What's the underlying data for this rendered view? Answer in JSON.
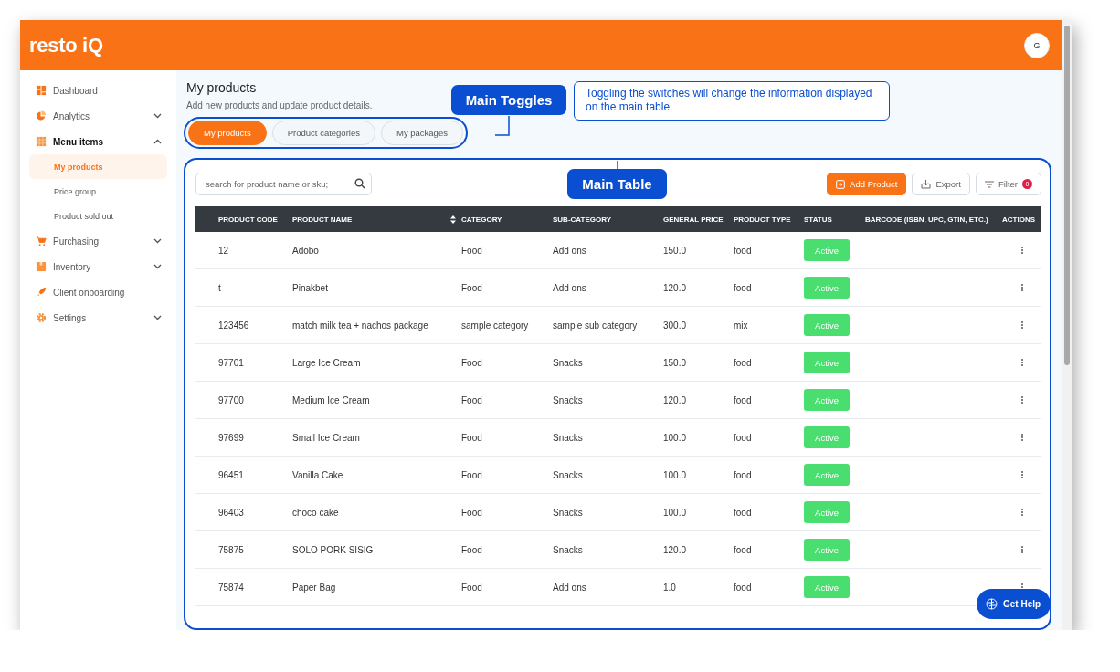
{
  "header": {
    "logo": "resto iQ",
    "avatar": "G"
  },
  "sidebar": {
    "items": [
      {
        "label": "Dashboard",
        "kind": "link",
        "selected": false
      },
      {
        "label": "Analytics",
        "kind": "group",
        "expanded": false,
        "selected": false
      },
      {
        "label": "Menu items",
        "kind": "group",
        "expanded": true,
        "selected": true,
        "children": [
          {
            "label": "My products",
            "selected": true
          },
          {
            "label": "Price group",
            "selected": false
          },
          {
            "label": "Product sold out",
            "selected": false
          }
        ]
      },
      {
        "label": "Purchasing",
        "kind": "group",
        "expanded": false,
        "selected": false
      },
      {
        "label": "Inventory",
        "kind": "group",
        "expanded": false,
        "selected": false
      },
      {
        "label": "Client onboarding",
        "kind": "link",
        "selected": false
      },
      {
        "label": "Settings",
        "kind": "group",
        "expanded": false,
        "selected": false
      }
    ]
  },
  "page": {
    "title": "My products",
    "subtitle": "Add new products and update product details.",
    "tabs": [
      {
        "label": "My products",
        "selected": true
      },
      {
        "label": "Product categories",
        "selected": false
      },
      {
        "label": "My packages",
        "selected": false
      }
    ],
    "search": {
      "placeholder": "search for product name or sku;"
    },
    "buttons": {
      "add": "Add Product",
      "export": "Export",
      "filter": "Filter",
      "filter_count": "0"
    },
    "table": {
      "columns": [
        {
          "label": "PRODUCT CODE",
          "sortable": false
        },
        {
          "label": "PRODUCT NAME",
          "sortable": true
        },
        {
          "label": "CATEGORY",
          "sortable": false
        },
        {
          "label": "SUB-CATEGORY",
          "sortable": false
        },
        {
          "label": "GENERAL PRICE",
          "sortable": false
        },
        {
          "label": "PRODUCT TYPE",
          "sortable": false
        },
        {
          "label": "STATUS",
          "sortable": false
        },
        {
          "label": "BARCODE (ISBN, UPC, GTIN, ETC.)",
          "sortable": false
        },
        {
          "label": "ACTIONS",
          "sortable": false
        }
      ],
      "rows": [
        {
          "code": "12",
          "name": "Adobo",
          "category": "Food",
          "sub_category": "Add ons",
          "price": "150.0",
          "type": "food",
          "status": "Active"
        },
        {
          "code": "t",
          "name": "Pinakbet",
          "category": "Food",
          "sub_category": "Add ons",
          "price": "120.0",
          "type": "food",
          "status": "Active"
        },
        {
          "code": "123456",
          "name": "match milk tea + nachos package",
          "category": "sample category",
          "sub_category": "sample sub category",
          "price": "300.0",
          "type": "mix",
          "status": "Active"
        },
        {
          "code": "97701",
          "name": "Large Ice Cream",
          "category": "Food",
          "sub_category": "Snacks",
          "price": "150.0",
          "type": "food",
          "status": "Active"
        },
        {
          "code": "97700",
          "name": "Medium Ice Cream",
          "category": "Food",
          "sub_category": "Snacks",
          "price": "120.0",
          "type": "food",
          "status": "Active"
        },
        {
          "code": "97699",
          "name": "Small Ice Cream",
          "category": "Food",
          "sub_category": "Snacks",
          "price": "100.0",
          "type": "food",
          "status": "Active"
        },
        {
          "code": "96451",
          "name": "Vanilla Cake",
          "category": "Food",
          "sub_category": "Snacks",
          "price": "100.0",
          "type": "food",
          "status": "Active"
        },
        {
          "code": "96403",
          "name": "choco cake",
          "category": "Food",
          "sub_category": "Snacks",
          "price": "100.0",
          "type": "food",
          "status": "Active"
        },
        {
          "code": "75875",
          "name": "SOLO PORK SISIG",
          "category": "Food",
          "sub_category": "Snacks",
          "price": "120.0",
          "type": "food",
          "status": "Active"
        },
        {
          "code": "75874",
          "name": "Paper Bag",
          "category": "Food",
          "sub_category": "Add ons",
          "price": "1.0",
          "type": "food",
          "status": "Active"
        }
      ]
    }
  },
  "annotations": {
    "toggles_tag": "Main Toggles",
    "note": "Toggling the switches will change the information displayed on the main table.",
    "table_tag": "Main Table"
  },
  "help": {
    "label": "Get Help"
  }
}
